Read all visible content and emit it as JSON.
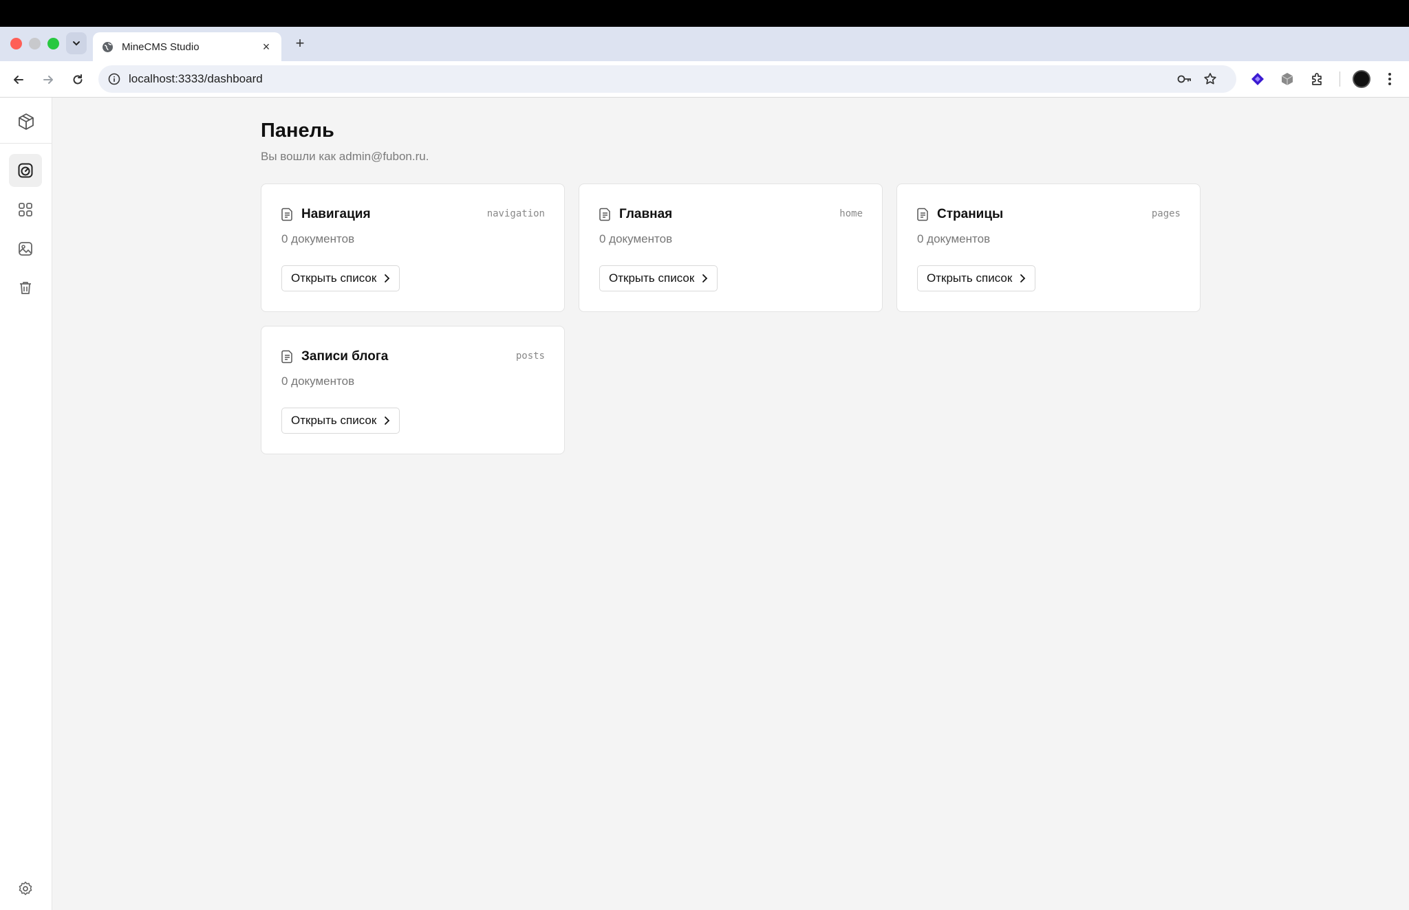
{
  "browser": {
    "tab_title": "MineCMS Studio",
    "tab_close": "×",
    "new_tab": "+",
    "url": "localhost:3333/dashboard"
  },
  "header": {
    "title": "Панель",
    "subtitle": "Вы вошли как admin@fubon.ru."
  },
  "sidebar": {
    "items": [
      {
        "name": "dashboard",
        "icon": "gauge-icon",
        "active": true
      },
      {
        "name": "collections",
        "icon": "grid-icon",
        "active": false
      },
      {
        "name": "media",
        "icon": "image-icon",
        "active": false
      },
      {
        "name": "trash",
        "icon": "trash-icon",
        "active": false
      }
    ],
    "footer_icon": "gear-icon"
  },
  "cards": [
    {
      "title": "Навигация",
      "slug": "navigation",
      "count": "0 документов",
      "button": "Открыть список"
    },
    {
      "title": "Главная",
      "slug": "home",
      "count": "0 документов",
      "button": "Открыть список"
    },
    {
      "title": "Страницы",
      "slug": "pages",
      "count": "0 документов",
      "button": "Открыть список"
    },
    {
      "title": "Записи блога",
      "slug": "posts",
      "count": "0 документов",
      "button": "Открыть список"
    }
  ],
  "colors": {
    "page_bg": "#f4f4f4",
    "card_bg": "#ffffff",
    "tabstrip_bg": "#dde3f1",
    "accent_extension": "#3b1ad1"
  }
}
